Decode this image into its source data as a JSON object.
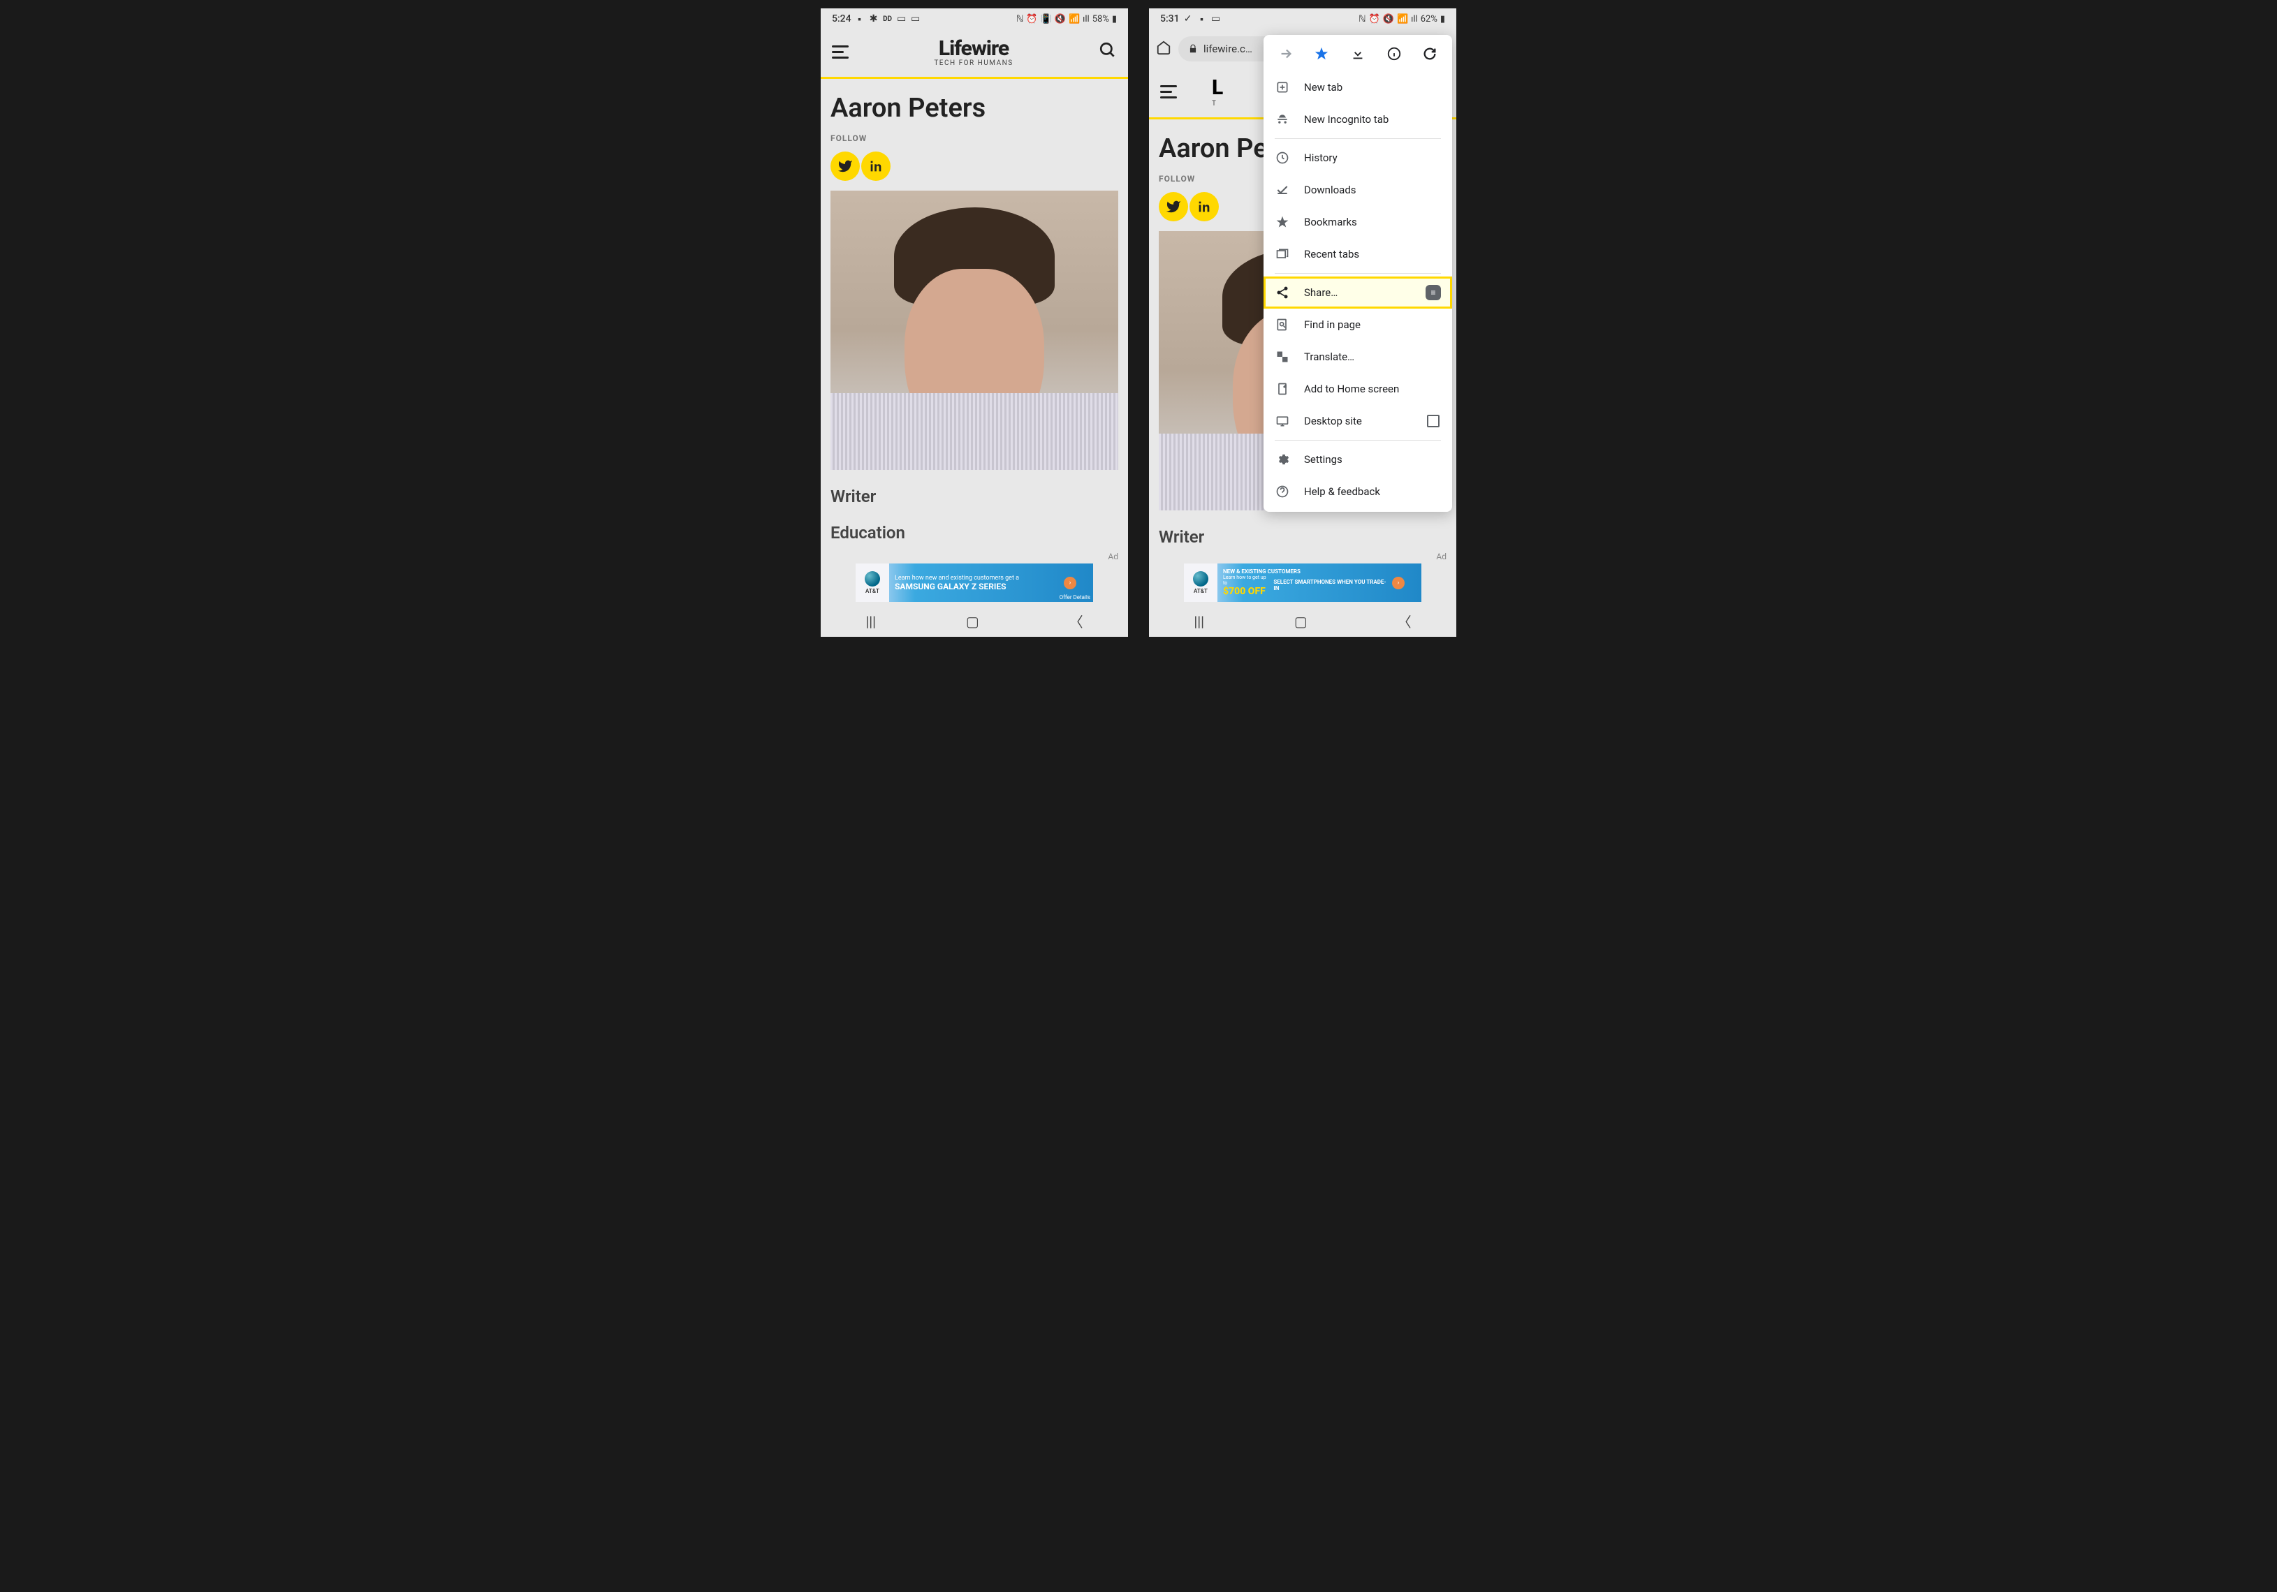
{
  "screen1": {
    "status": {
      "time": "5:24",
      "battery": "58%",
      "left_indicators": [
        "ebx",
        "✱",
        "DD",
        "⊞",
        "⊟"
      ],
      "right_indicators": [
        "N",
        "⏰",
        "🔕",
        "📶",
        "ıll"
      ]
    },
    "brand": {
      "name": "Lifewire",
      "tagline": "TECH FOR HUMANS"
    },
    "author": {
      "name": "Aaron Peters",
      "follow": "FOLLOW"
    },
    "sections": {
      "writer": "Writer",
      "education": "Education"
    },
    "ad_label": "Ad",
    "ad": {
      "brand": "AT&T",
      "line1": "Learn how new and existing customers get a",
      "line2": "SAMSUNG GALAXY Z SERIES",
      "details": "Offer Details"
    }
  },
  "screen2": {
    "status": {
      "time": "5:31",
      "battery": "62%",
      "left_indicators": [
        "✓",
        "ebx",
        "⊟"
      ],
      "right_indicators": [
        "N",
        "⏰",
        "🔕",
        "📶",
        "ıll"
      ]
    },
    "browser": {
      "url_display": "lifewire.c…"
    },
    "brand": {
      "name_partial": "L",
      "tagline_partial": "T"
    },
    "author": {
      "name_partial": "Aaron Pe",
      "follow": "FOLLOW"
    },
    "sections": {
      "writer": "Writer"
    },
    "ad_label": "Ad",
    "ad": {
      "brand": "AT&T",
      "line1": "NEW & EXISTING CUSTOMERS",
      "line2a": "Learn how to get up to",
      "line2b": "$700 OFF",
      "line3": "SELECT SMARTPHONES WHEN YOU TRADE-IN"
    },
    "menu": {
      "new_tab": "New tab",
      "incognito": "New Incognito tab",
      "history": "History",
      "downloads": "Downloads",
      "bookmarks": "Bookmarks",
      "recent_tabs": "Recent tabs",
      "share": "Share…",
      "find": "Find in page",
      "translate": "Translate…",
      "add_home": "Add to Home screen",
      "desktop": "Desktop site",
      "settings": "Settings",
      "help": "Help & feedback"
    }
  }
}
